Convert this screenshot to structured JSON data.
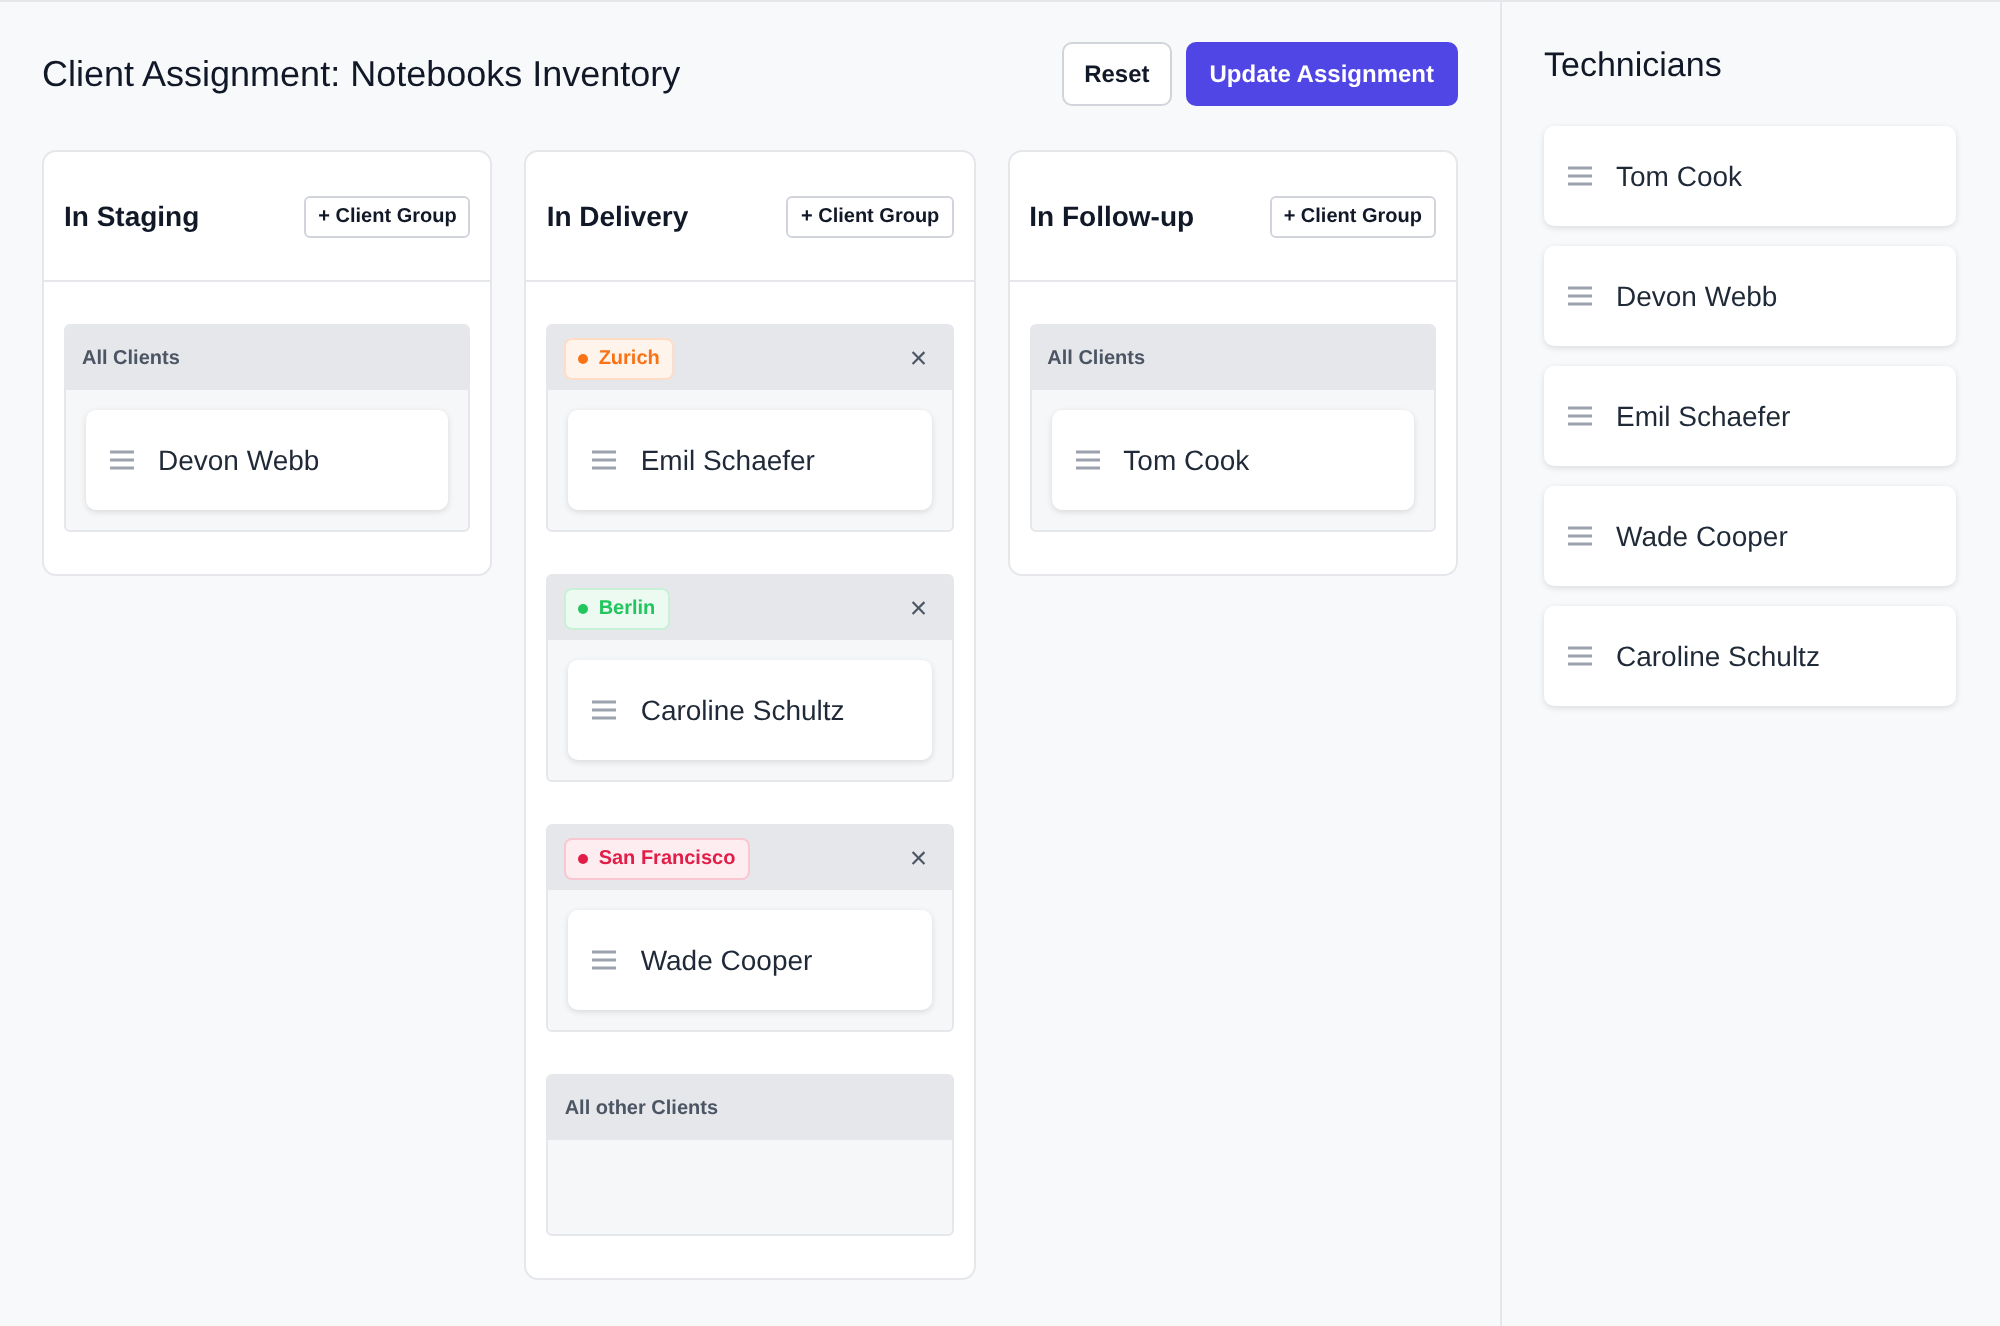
{
  "title": "Client Assignment: Notebooks Inventory",
  "buttons": [
    {
      "label": "Reset",
      "kind": "secondary"
    },
    {
      "label": "Update Assignment",
      "kind": "primary"
    }
  ],
  "columns": [
    {
      "title": "In Staging",
      "add_button": "+ Client Group",
      "groups": [
        {
          "kind": "all",
          "label": "All Clients",
          "members": [
            "Devon Webb"
          ]
        }
      ]
    },
    {
      "title": "In Delivery",
      "add_button": "+ Client Group",
      "groups": [
        {
          "kind": "location",
          "label": "Zurich",
          "color": "#f97316",
          "close": "×",
          "members": [
            "Emil Schaefer"
          ]
        },
        {
          "kind": "location",
          "label": "Berlin",
          "color": "#22c55e",
          "close": "×",
          "members": [
            "Caroline Schultz"
          ]
        },
        {
          "kind": "location",
          "label": "San Francisco",
          "color": "#e11d48",
          "close": "×",
          "members": [
            "Wade Cooper"
          ]
        },
        {
          "kind": "all",
          "label": "All other Clients"
        }
      ]
    },
    {
      "title": "In Follow-up",
      "add_button": "+ Client Group",
      "groups": [
        {
          "kind": "all",
          "label": "All Clients",
          "members": [
            "Tom Cook"
          ]
        }
      ]
    }
  ],
  "sidebar": {
    "title": "Technicians",
    "items": [
      "Tom Cook",
      "Devon Webb",
      "Emil Schaefer",
      "Wade Cooper",
      "Caroline Schultz"
    ]
  }
}
